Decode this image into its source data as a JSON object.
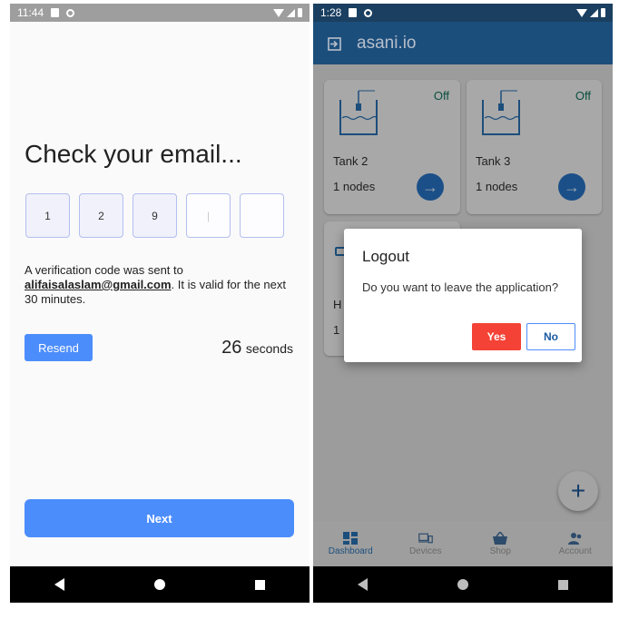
{
  "left": {
    "status": {
      "time": "11:44"
    },
    "title": "Check your email...",
    "code_digits": [
      "1",
      "2",
      "9",
      "|",
      ""
    ],
    "info_prefix": "A verification code was sent to ",
    "email": "alifaisalaslam@gmail.com",
    "info_suffix": ". It is valid for the next 30 minutes.",
    "resend_label": "Resend",
    "countdown_value": "26",
    "countdown_unit": "seconds",
    "next_label": "Next"
  },
  "right": {
    "status": {
      "time": "1:28"
    },
    "app_title": "asani.io",
    "cards": [
      {
        "name": "Tank 2",
        "nodes": "1 nodes",
        "status": "Off"
      },
      {
        "name": "Tank 3",
        "nodes": "1 nodes",
        "status": "Off"
      }
    ],
    "partial_card": {
      "name_fragment": "H",
      "nodes_fragment": "1"
    },
    "dialog": {
      "title": "Logout",
      "message": "Do you want to leave the application?",
      "yes_label": "Yes",
      "no_label": "No"
    },
    "fab_icon": "plus-icon",
    "bottom_nav": [
      {
        "label": "Dashboard",
        "icon": "dashboard-icon",
        "active": true
      },
      {
        "label": "Devices",
        "icon": "devices-icon",
        "active": false
      },
      {
        "label": "Shop",
        "icon": "shop-basket-icon",
        "active": false
      },
      {
        "label": "Account",
        "icon": "account-icon",
        "active": false
      }
    ]
  },
  "colors": {
    "primary_blue": "#4c8dfc",
    "appbar_blue": "#1c4e7c",
    "yes_red": "#f44336",
    "status_green": "#0b4f3d"
  }
}
